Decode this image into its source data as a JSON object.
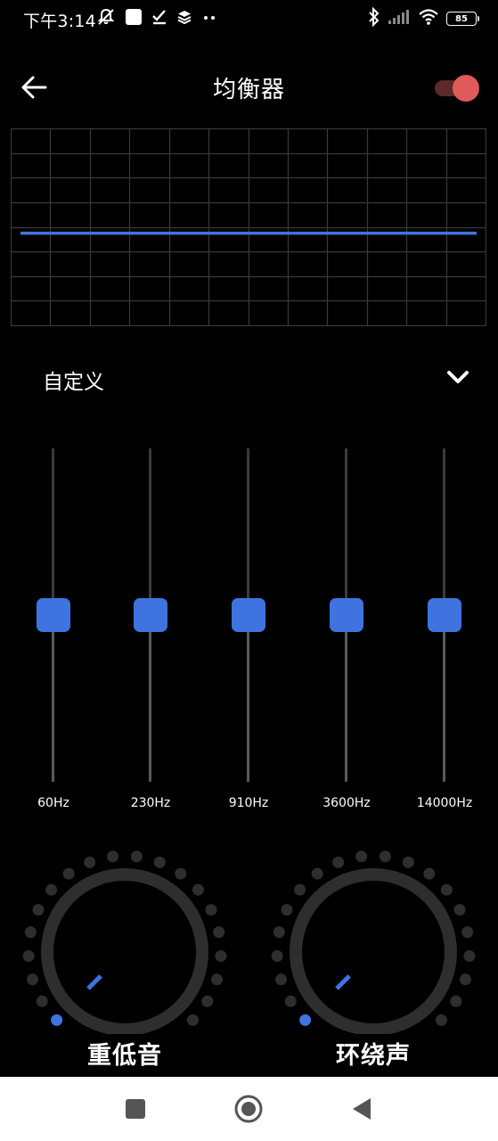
{
  "status_bar": {
    "time": "下午3:14",
    "left_icons": [
      "muted-bell-icon",
      "app-square-icon",
      "checkmark-icon",
      "layers-icon",
      "more-dots-icon"
    ],
    "right_icons": [
      "bluetooth-icon",
      "cellular-signal-icon",
      "wifi-icon"
    ],
    "battery": "85"
  },
  "header": {
    "title": "均衡器",
    "toggle_on": true,
    "toggle_color": "#e05a5a"
  },
  "preset": {
    "label": "自定义"
  },
  "bands": [
    {
      "label": "60Hz",
      "level": 0.5
    },
    {
      "label": "230Hz",
      "level": 0.5
    },
    {
      "label": "910Hz",
      "level": 0.5
    },
    {
      "label": "3600Hz",
      "level": 0.5
    },
    {
      "label": "14000Hz",
      "level": 0.5
    }
  ],
  "knobs": [
    {
      "label": "重低音",
      "level": 0
    },
    {
      "label": "环绕声",
      "level": 0
    }
  ],
  "colors": {
    "accent": "#3f74e0",
    "background": "#000000"
  },
  "nav_bar": [
    "recents-square-icon",
    "home-circle-icon",
    "back-triangle-icon"
  ]
}
